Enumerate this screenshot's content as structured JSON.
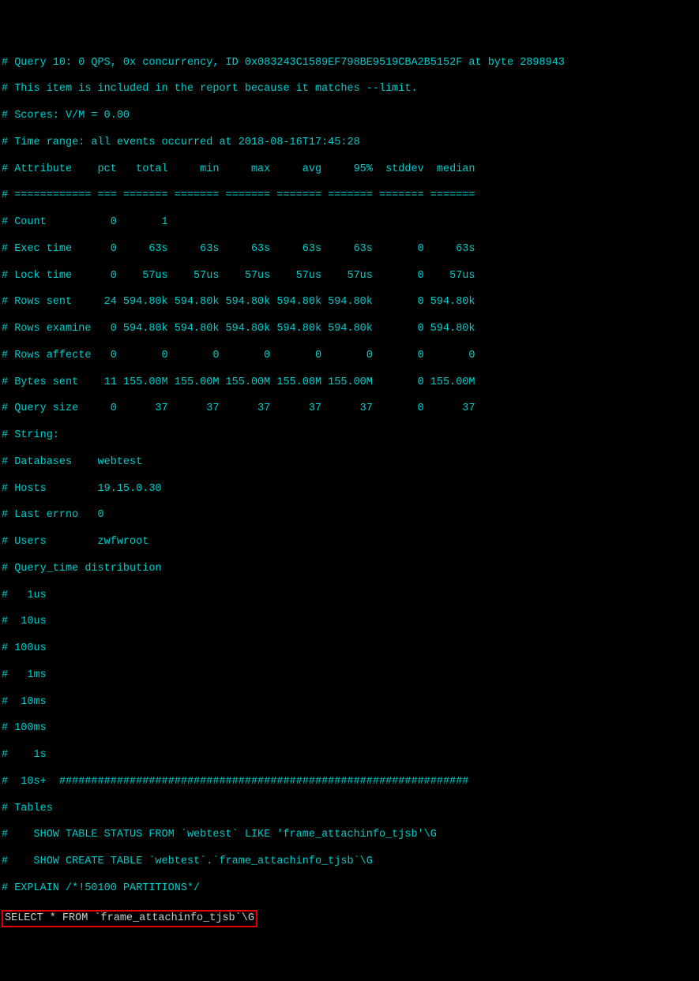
{
  "header": {
    "l1": "# Query 10: 0 QPS, 0x concurrency, ID 0x083243C1589EF798BE9519CBA2B5152F at byte 2898943",
    "l2": "# This item is included in the report because it matches --limit.",
    "l3": "# Scores: V/M = 0.00",
    "l4": "# Time range: all events occurred at 2018-08-16T17:45:28"
  },
  "table": {
    "head": "# Attribute    pct   total     min     max     avg     95%  stddev  median",
    "sep": "# ============ === ======= ======= ======= ======= ======= ======= =======",
    "rows": [
      "# Count          0       1",
      "# Exec time      0     63s     63s     63s     63s     63s       0     63s",
      "# Lock time      0    57us    57us    57us    57us    57us       0    57us",
      "# Rows sent     24 594.80k 594.80k 594.80k 594.80k 594.80k       0 594.80k",
      "# Rows examine   0 594.80k 594.80k 594.80k 594.80k 594.80k       0 594.80k",
      "# Rows affecte   0       0       0       0       0       0       0       0",
      "# Bytes sent    11 155.00M 155.00M 155.00M 155.00M 155.00M       0 155.00M",
      "# Query size     0      37      37      37      37      37       0      37"
    ]
  },
  "meta": [
    "# String:",
    "# Databases    webtest",
    "# Hosts        19.15.0.30",
    "# Last errno   0",
    "# Users        zwfwroot",
    "# Query_time distribution",
    "#   1us",
    "#  10us",
    "# 100us",
    "#   1ms",
    "#  10ms",
    "# 100ms",
    "#    1s",
    "#  10s+  ################################################################",
    "# Tables",
    "#    SHOW TABLE STATUS FROM `webtest` LIKE 'frame_attachinfo_tjsb'\\G",
    "#    SHOW CREATE TABLE `webtest`.`frame_attachinfo_tjsb`\\G",
    "# EXPLAIN /*!50100 PARTITIONS*/"
  ],
  "highlighted_query": "SELECT * FROM `frame_attachinfo_tjsb`\\G",
  "chart_data": {
    "type": "table",
    "title": "Query 10 attribute statistics",
    "columns": [
      "Attribute",
      "pct",
      "total",
      "min",
      "max",
      "avg",
      "95%",
      "stddev",
      "median"
    ],
    "rows": [
      {
        "Attribute": "Count",
        "pct": 0,
        "total": "1",
        "min": "",
        "max": "",
        "avg": "",
        "95%": "",
        "stddev": "",
        "median": ""
      },
      {
        "Attribute": "Exec time",
        "pct": 0,
        "total": "63s",
        "min": "63s",
        "max": "63s",
        "avg": "63s",
        "95%": "63s",
        "stddev": "0",
        "median": "63s"
      },
      {
        "Attribute": "Lock time",
        "pct": 0,
        "total": "57us",
        "min": "57us",
        "max": "57us",
        "avg": "57us",
        "95%": "57us",
        "stddev": "0",
        "median": "57us"
      },
      {
        "Attribute": "Rows sent",
        "pct": 24,
        "total": "594.80k",
        "min": "594.80k",
        "max": "594.80k",
        "avg": "594.80k",
        "95%": "594.80k",
        "stddev": "0",
        "median": "594.80k"
      },
      {
        "Attribute": "Rows examine",
        "pct": 0,
        "total": "594.80k",
        "min": "594.80k",
        "max": "594.80k",
        "avg": "594.80k",
        "95%": "594.80k",
        "stddev": "0",
        "median": "594.80k"
      },
      {
        "Attribute": "Rows affecte",
        "pct": 0,
        "total": "0",
        "min": "0",
        "max": "0",
        "avg": "0",
        "95%": "0",
        "stddev": "0",
        "median": "0"
      },
      {
        "Attribute": "Bytes sent",
        "pct": 11,
        "total": "155.00M",
        "min": "155.00M",
        "max": "155.00M",
        "avg": "155.00M",
        "95%": "155.00M",
        "stddev": "0",
        "median": "155.00M"
      },
      {
        "Attribute": "Query size",
        "pct": 0,
        "total": "37",
        "min": "37",
        "max": "37",
        "avg": "37",
        "95%": "37",
        "stddev": "0",
        "median": "37"
      }
    ]
  }
}
